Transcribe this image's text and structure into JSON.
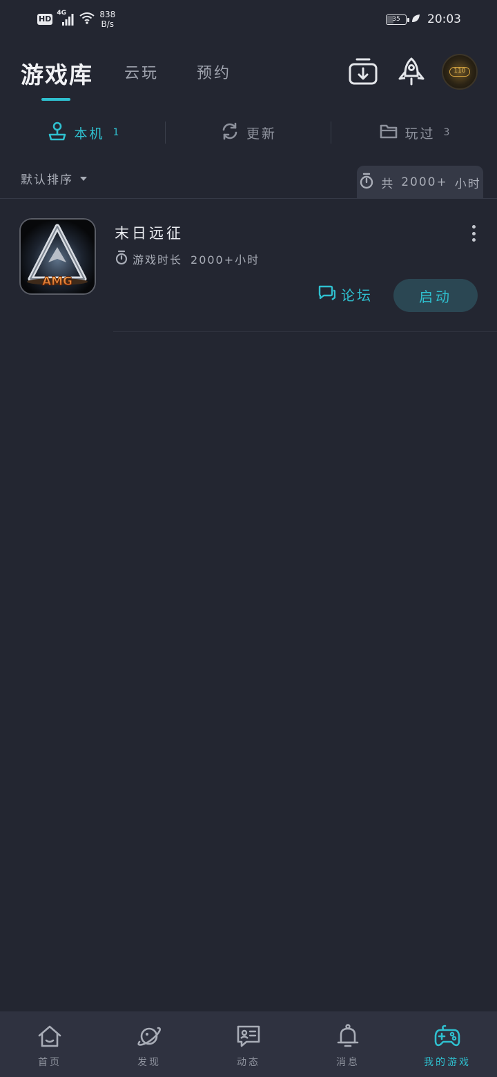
{
  "status_bar": {
    "hd": "HD",
    "network": "4G",
    "speed_value": "838",
    "speed_unit": "B/s",
    "battery": "35",
    "battery_level": 0.35,
    "time": "20:03"
  },
  "header": {
    "tabs": [
      {
        "label": "游戏库",
        "active": true
      },
      {
        "label": "云玩",
        "active": false
      },
      {
        "label": "预约",
        "active": false
      }
    ],
    "avatar_text": "110",
    "accent_color": "#2fc0cf"
  },
  "sub_tabs": [
    {
      "label": "本机",
      "count": "1",
      "icon": "joystick-icon",
      "active": true
    },
    {
      "label": "更新",
      "count": "",
      "icon": "refresh-icon",
      "active": false
    },
    {
      "label": "玩过",
      "count": "3",
      "icon": "folder-icon",
      "active": false
    }
  ],
  "sort": {
    "label": "默认排序",
    "total_prefix": "共",
    "total_value": "2000+",
    "total_unit": "小时"
  },
  "games": [
    {
      "title": "末日远征",
      "icon_text": "AMG",
      "playtime_label": "游戏时长",
      "playtime_value": "2000+小时",
      "forum_label": "论坛",
      "launch_label": "启动"
    }
  ],
  "bottom_nav": [
    {
      "label": "首页",
      "icon": "home-icon",
      "active": false
    },
    {
      "label": "发现",
      "icon": "planet-icon",
      "active": false
    },
    {
      "label": "动态",
      "icon": "feed-icon",
      "active": false
    },
    {
      "label": "消息",
      "icon": "bell-icon",
      "active": false
    },
    {
      "label": "我的游戏",
      "icon": "gamepad-icon",
      "active": true
    }
  ]
}
